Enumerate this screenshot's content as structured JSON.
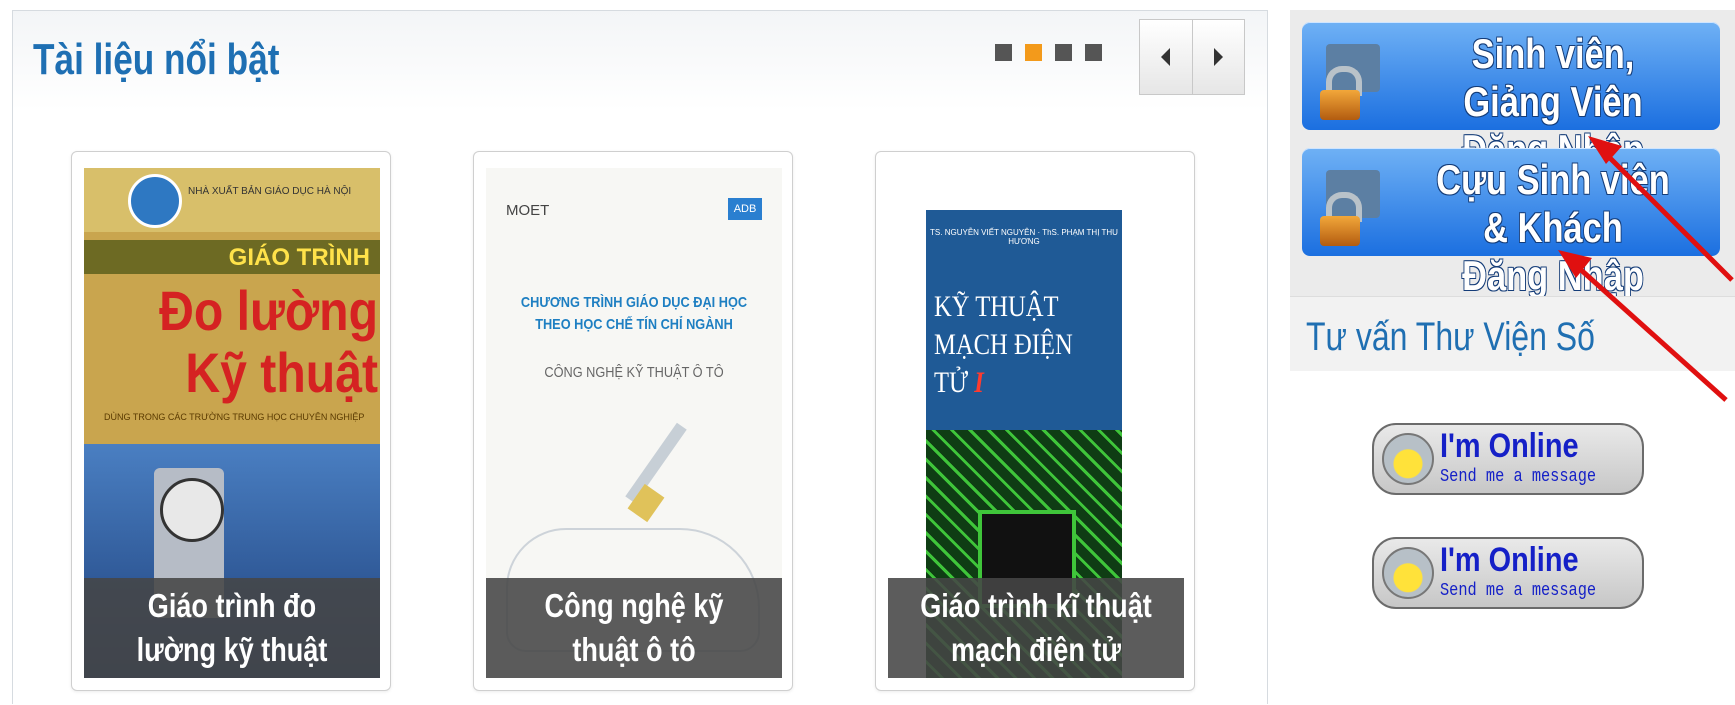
{
  "featured": {
    "title": "Tài liệu nổi bật",
    "pager": {
      "count": 4,
      "active_index": 1
    },
    "books": [
      {
        "caption": "Giáo trình đo lường kỹ thuật",
        "cover": {
          "publisher": "NHÀ XUẤT BẢN GIÁO DỤC HÀ NỘI",
          "label": "GIÁO TRÌNH",
          "title": "Đo lường Kỹ thuật",
          "subtitle": "DÙNG TRONG CÁC TRƯỜNG TRUNG HỌC CHUYÊN NGHIỆP"
        }
      },
      {
        "caption": "Công nghệ kỹ thuật ô tô",
        "cover": {
          "left_mark": "MOET",
          "right_mark": "ADB",
          "line1": "CHƯƠNG TRÌNH GIÁO DỤC ĐẠI HỌC",
          "line2": "THEO HỌC CHẾ TÍN CHỈ NGÀNH",
          "line3": "CÔNG NGHỆ KỸ THUẬT Ô TÔ"
        }
      },
      {
        "caption": "Giáo trình kĩ thuật mạch điện tử",
        "cover": {
          "authors": "TS. NGUYỄN VIẾT NGUYÊN · ThS. PHẠM THỊ THU HƯƠNG",
          "title_line1": "KỸ THUẬT",
          "title_line2": "MẠCH ĐIỆN TỬ",
          "volume": "I"
        }
      }
    ]
  },
  "sidebar": {
    "login_student_staff": "Sinh viên, Giảng Viên\nĐăng Nhập",
    "login_alumni_guest": "Cựu Sinh viên & Khách\nĐăng Nhập",
    "consult_title": "Tư vấn Thư Viện Số",
    "online_badges": [
      {
        "main": "I'm Online",
        "sub": "Send me a message"
      },
      {
        "main": "I'm Online",
        "sub": "Send me a message"
      }
    ]
  },
  "colors": {
    "accent": "#1e6fb3",
    "login_blue": "#1b6fe0",
    "pager_active": "#f39a1b",
    "annotation_arrow": "#e01010"
  }
}
